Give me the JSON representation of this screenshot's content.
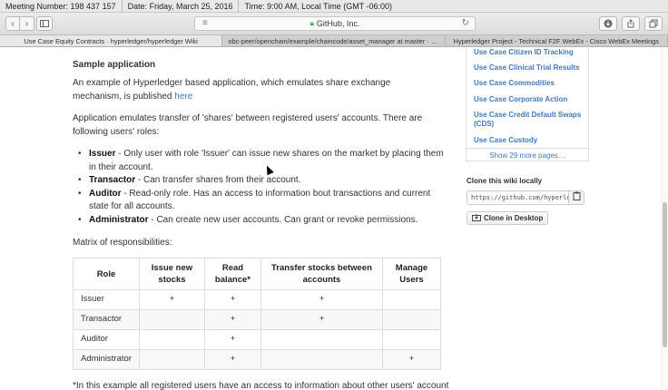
{
  "meeting": {
    "number": "Meeting Number: 198 437 157",
    "date": "Date: Friday, March 25, 2016",
    "time": "Time: 9:00 AM, Local Time (GMT -06:00)"
  },
  "browser": {
    "address": "GitHub, Inc.",
    "back_icon": "chevron-left-icon",
    "forward_icon": "chevron-right-icon"
  },
  "tabs": [
    {
      "label": "Use Case Equity Contracts · hyperledger/hyperledger Wiki",
      "active": true
    },
    {
      "label": "obc-peer/openchain/example/chaincode/asset_manager at master · sta...",
      "active": false
    },
    {
      "label": "Hyperledger Project - Technical F2F WebEx - Cisco WebEx Meetings",
      "active": false
    }
  ],
  "article": {
    "heading": "Sample application",
    "intro_text": "An example of Hyperledger based application, which emulates share exchange mechanism, is published",
    "intro_link": "here",
    "roles_intro": "Application emulates transfer of 'shares' between registered users' accounts. There are following users' roles:",
    "roles": [
      {
        "name": "Issuer",
        "desc": " - Only user with role 'Issuer' can issue new shares on the market by placing them in their account."
      },
      {
        "name": "Transactor",
        "desc": " - Can transfer shares from their account."
      },
      {
        "name": "Auditor",
        "desc": " - Read-only role. Has an access to information bout transactions and current state for all accounts."
      },
      {
        "name": "Administrator",
        "desc": " - Can create new user accounts. Can grant or revoke permissions."
      }
    ],
    "matrix_label": "Matrix of responsibilities:",
    "table": {
      "headers": [
        "Role",
        "Issue new stocks",
        "Read balance*",
        "Transfer stocks between accounts",
        "Manage Users"
      ],
      "rows": [
        [
          "Issuer",
          "+",
          "+",
          "+",
          ""
        ],
        [
          "Transactor",
          "",
          "+",
          "+",
          ""
        ],
        [
          "Auditor",
          "",
          "+",
          "",
          ""
        ],
        [
          "Administrator",
          "",
          "+",
          "",
          "+"
        ]
      ]
    },
    "footnote": "*In this example all registered users have an access to information about other users' account"
  },
  "wiki_sidebar": {
    "pages": [
      "Use Case Citizen ID Tracking",
      "Use Case Clinical Trial Results",
      "Use Case Commodities",
      "Use Case Corporate Action",
      "Use Case Credit Default Swaps (CDS)",
      "Use Case Custody"
    ],
    "more_pages": "Show 29 more pages…",
    "clone_label": "Clone this wiki locally",
    "clone_url": "https://github.com/hyperledger/hyperledger.wiki.git",
    "clone_desktop": "Clone in Desktop"
  }
}
